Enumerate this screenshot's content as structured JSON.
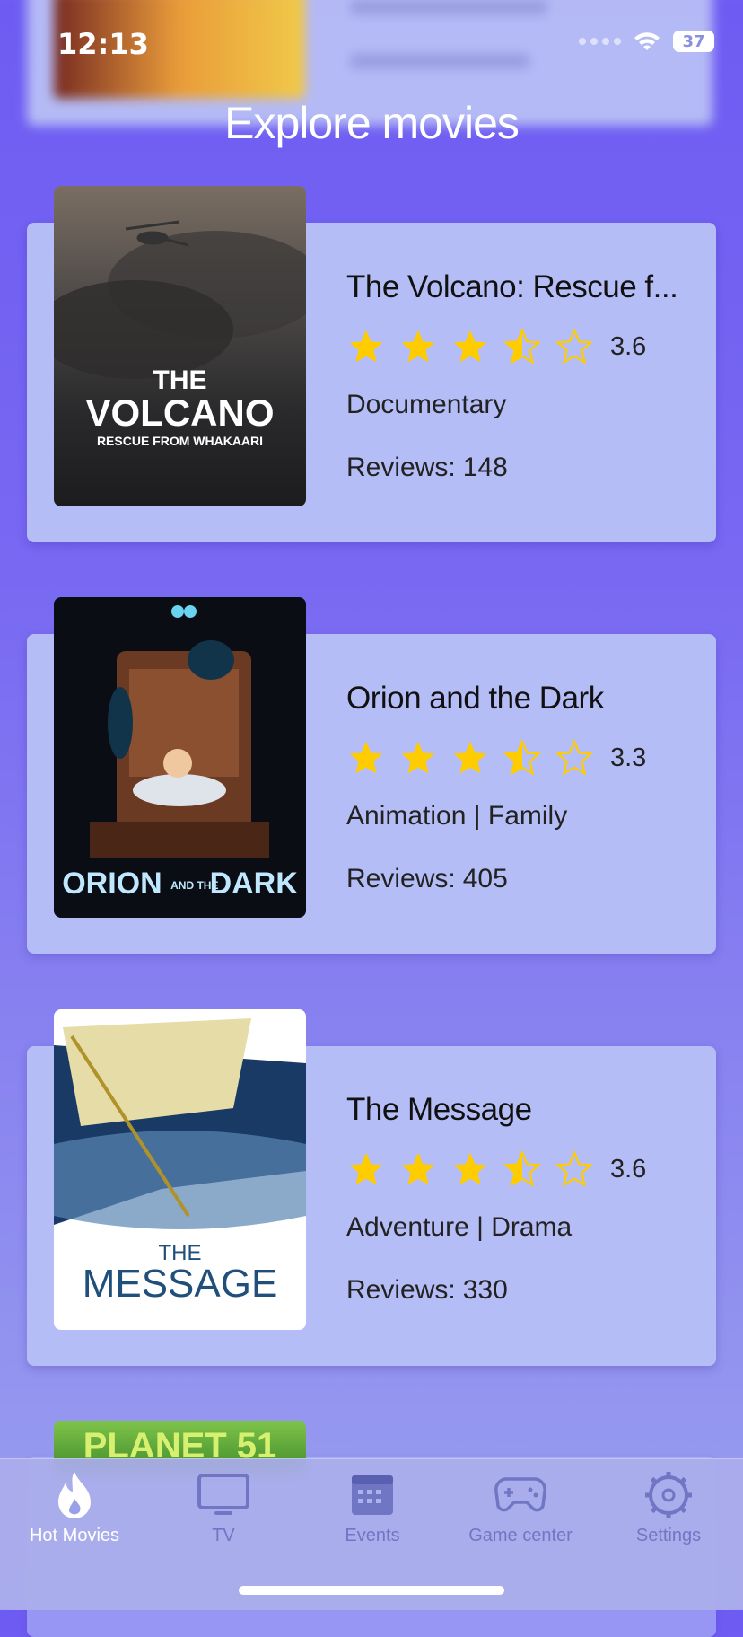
{
  "status": {
    "time": "12:13",
    "battery": "37"
  },
  "page_title": "Explore movies",
  "movies": [
    {
      "title": "The Volcano: Rescue f...",
      "rating": "3.6",
      "genre": "Documentary",
      "reviews_label": "Reviews:",
      "reviews": "148",
      "poster": {
        "line1": "THE",
        "line2": "VOLCANO",
        "line3": "RESCUE FROM WHAKAARI"
      }
    },
    {
      "title": "Orion and the Dark",
      "rating": "3.3",
      "genre": "Animation | Family",
      "reviews_label": "Reviews:",
      "reviews": "405",
      "poster": {
        "line1": "ORION",
        "line2": "AND THE",
        "line3": "DARK"
      }
    },
    {
      "title": "The Message",
      "rating": "3.6",
      "genre": "Adventure | Drama",
      "reviews_label": "Reviews:",
      "reviews": "330",
      "poster": {
        "line1": "THE",
        "line2": "MESSAGE"
      }
    }
  ],
  "next_poster_text": "PLANET 51",
  "tabs": [
    {
      "label": "Hot Movies",
      "icon": "flame-icon",
      "active": true
    },
    {
      "label": "TV",
      "icon": "tv-icon",
      "active": false
    },
    {
      "label": "Events",
      "icon": "calendar-icon",
      "active": false
    },
    {
      "label": "Game center",
      "icon": "gamepad-icon",
      "active": false
    },
    {
      "label": "Settings",
      "icon": "gear-icon",
      "active": false
    }
  ],
  "colors": {
    "background": "#7263f2",
    "card": "#b5bdf6",
    "star": "#ffcc00",
    "tab_inactive": "#7076c4"
  }
}
